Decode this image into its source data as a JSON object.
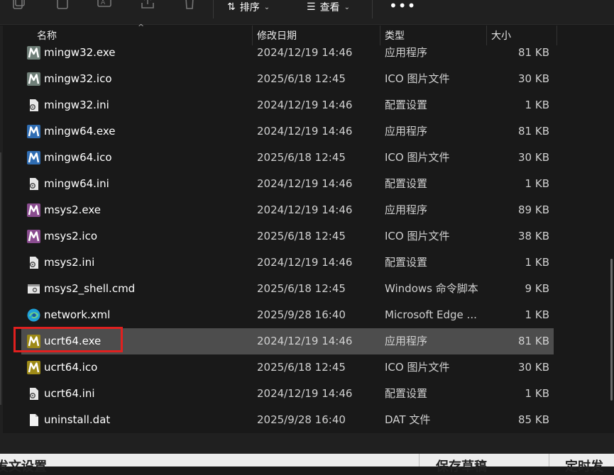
{
  "toolbar": {
    "sort_label": "排序",
    "view_label": "查看",
    "more_label": "•••"
  },
  "columns": {
    "name": "名称",
    "date": "修改日期",
    "type": "类型",
    "size": "大小"
  },
  "files": [
    {
      "name": "mingw32.exe",
      "date": "2024/12/19 14:46",
      "type": "应用程序",
      "size": "81 KB",
      "icon": "mingw32-app-icon",
      "color": "#6f7f78"
    },
    {
      "name": "mingw32.ico",
      "date": "2025/6/18 12:45",
      "type": "ICO 图片文件",
      "size": "30 KB",
      "icon": "mingw32-app-icon",
      "color": "#6f7f78"
    },
    {
      "name": "mingw32.ini",
      "date": "2024/12/19 14:46",
      "type": "配置设置",
      "size": "1 KB",
      "icon": "settings-file-icon",
      "color": "#e6e6e6"
    },
    {
      "name": "mingw64.exe",
      "date": "2024/12/19 14:46",
      "type": "应用程序",
      "size": "81 KB",
      "icon": "mingw64-app-icon",
      "color": "#2f6db3"
    },
    {
      "name": "mingw64.ico",
      "date": "2025/6/18 12:45",
      "type": "ICO 图片文件",
      "size": "30 KB",
      "icon": "mingw64-app-icon",
      "color": "#2f6db3"
    },
    {
      "name": "mingw64.ini",
      "date": "2024/12/19 14:46",
      "type": "配置设置",
      "size": "1 KB",
      "icon": "settings-file-icon",
      "color": "#e6e6e6"
    },
    {
      "name": "msys2.exe",
      "date": "2024/12/19 14:46",
      "type": "应用程序",
      "size": "89 KB",
      "icon": "msys2-app-icon",
      "color": "#8a4c8f"
    },
    {
      "name": "msys2.ico",
      "date": "2025/6/18 12:45",
      "type": "ICO 图片文件",
      "size": "38 KB",
      "icon": "msys2-app-icon",
      "color": "#8a4c8f"
    },
    {
      "name": "msys2.ini",
      "date": "2024/12/19 14:46",
      "type": "配置设置",
      "size": "1 KB",
      "icon": "settings-file-icon",
      "color": "#e6e6e6"
    },
    {
      "name": "msys2_shell.cmd",
      "date": "2025/6/18 12:45",
      "type": "Windows 命令脚本",
      "size": "9 KB",
      "icon": "cmd-file-icon",
      "color": "#e6e6e6"
    },
    {
      "name": "network.xml",
      "date": "2025/9/28 16:40",
      "type": "Microsoft Edge ...",
      "size": "1 KB",
      "icon": "edge-icon",
      "color": "#1fa0d8"
    },
    {
      "name": "ucrt64.exe",
      "date": "2024/12/19 14:46",
      "type": "应用程序",
      "size": "81 KB",
      "icon": "ucrt64-app-icon",
      "color": "#9d8a17",
      "selected": true
    },
    {
      "name": "ucrt64.ico",
      "date": "2025/6/18 12:45",
      "type": "ICO 图片文件",
      "size": "30 KB",
      "icon": "ucrt64-app-icon",
      "color": "#9d8a17"
    },
    {
      "name": "ucrt64.ini",
      "date": "2024/12/19 14:46",
      "type": "配置设置",
      "size": "1 KB",
      "icon": "settings-file-icon",
      "color": "#e6e6e6"
    },
    {
      "name": "uninstall.dat",
      "date": "2025/9/28 16:40",
      "type": "DAT 文件",
      "size": "85 KB",
      "icon": "blank-file-icon",
      "color": "#f2f2f2"
    }
  ],
  "bottom": {
    "left_text": "发文设置",
    "middle_text": "保存草稿",
    "right_text": "定时发"
  },
  "colors": {
    "selection": "#4d4d4d",
    "highlight_box": "#e0201f",
    "background": "#191919"
  }
}
